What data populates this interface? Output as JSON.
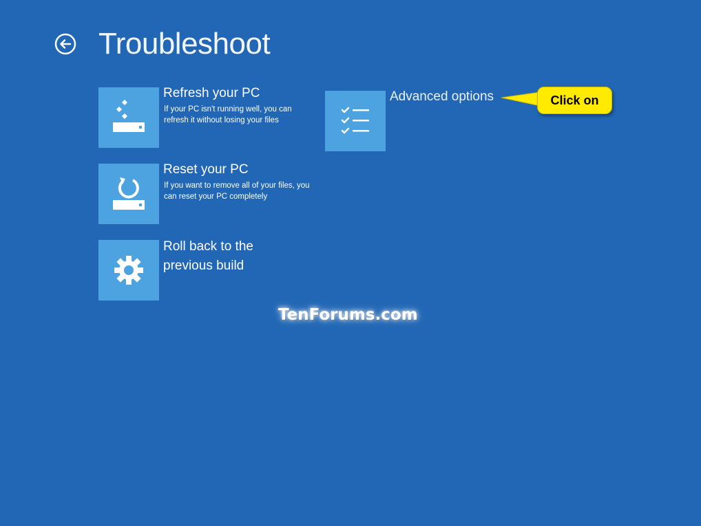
{
  "header": {
    "title": "Troubleshoot"
  },
  "options": [
    {
      "title": "Refresh your PC",
      "description": "If your PC isn't running well, you can refresh it without losing your files",
      "icon": "refresh-drive-icon"
    },
    {
      "title": "Reset your PC",
      "description": "If you want to remove all of your files, you can reset your PC completely",
      "icon": "reset-drive-icon"
    },
    {
      "title": "Roll back to the previous build",
      "icon": "gear-icon"
    },
    {
      "title": "Advanced options",
      "icon": "checklist-icon"
    }
  ],
  "callout": {
    "text": "Click on"
  },
  "watermark": "TenForums.com",
  "colors": {
    "background": "#2167b5",
    "tile": "#4ca3e0",
    "callout": "#ffea00"
  }
}
